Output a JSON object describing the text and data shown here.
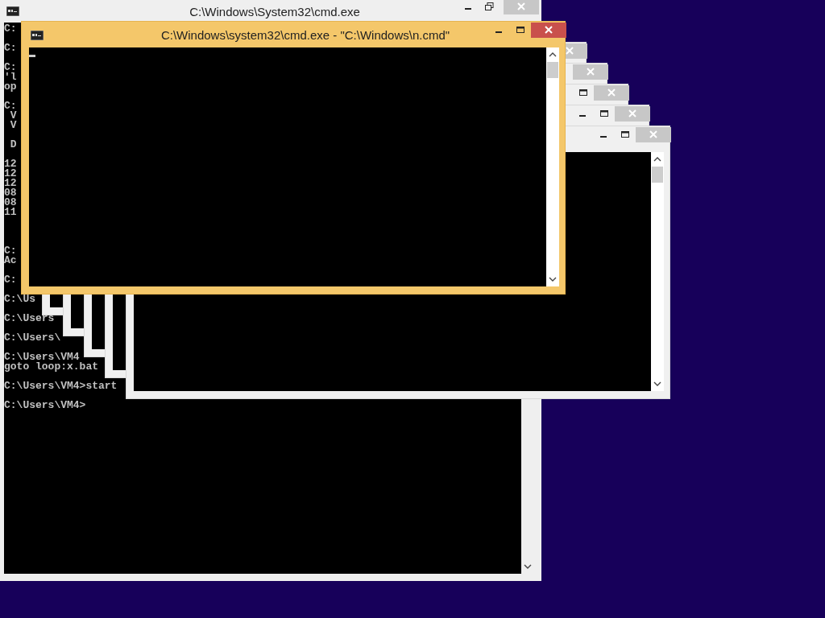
{
  "desktop": {
    "windows": [
      {
        "title": "C:\\Windows\\System32\\cmd.exe",
        "active": false,
        "buttons": [
          {
            "kind": "minimize"
          },
          {
            "kind": "restore"
          },
          {
            "kind": "close"
          }
        ],
        "console_lines": [
          "C:",
          "C:",
          "C:",
          "'l",
          "op",
          "C:",
          " V",
          " V",
          " D",
          "12",
          "12",
          "12",
          "08",
          "08",
          "11",
          "C:",
          "Ac",
          "C:",
          "C:\\Us",
          "C:\\Users",
          "C:\\Users\\",
          "C:\\Users\\VM4",
          "goto loop:x.bat",
          "C:\\Users\\VM4>start",
          "C:\\Users\\VM4>"
        ]
      },
      {
        "active": false,
        "buttons": [
          {
            "kind": "close"
          }
        ]
      },
      {
        "active": false,
        "buttons": [
          {
            "kind": "close"
          }
        ]
      },
      {
        "active": false,
        "buttons": [
          {
            "kind": "maximize"
          },
          {
            "kind": "close"
          }
        ]
      },
      {
        "active": false,
        "buttons": [
          {
            "kind": "minimize"
          },
          {
            "kind": "maximize"
          },
          {
            "kind": "close"
          }
        ]
      },
      {
        "active": false,
        "buttons": [
          {
            "kind": "minimize"
          },
          {
            "kind": "maximize"
          },
          {
            "kind": "close"
          }
        ]
      },
      {
        "title": "C:\\Windows\\system32\\cmd.exe - \"C:\\Windows\\n.cmd\"",
        "active": true,
        "buttons": [
          {
            "kind": "minimize"
          },
          {
            "kind": "maximize"
          },
          {
            "kind": "close"
          }
        ]
      }
    ]
  }
}
